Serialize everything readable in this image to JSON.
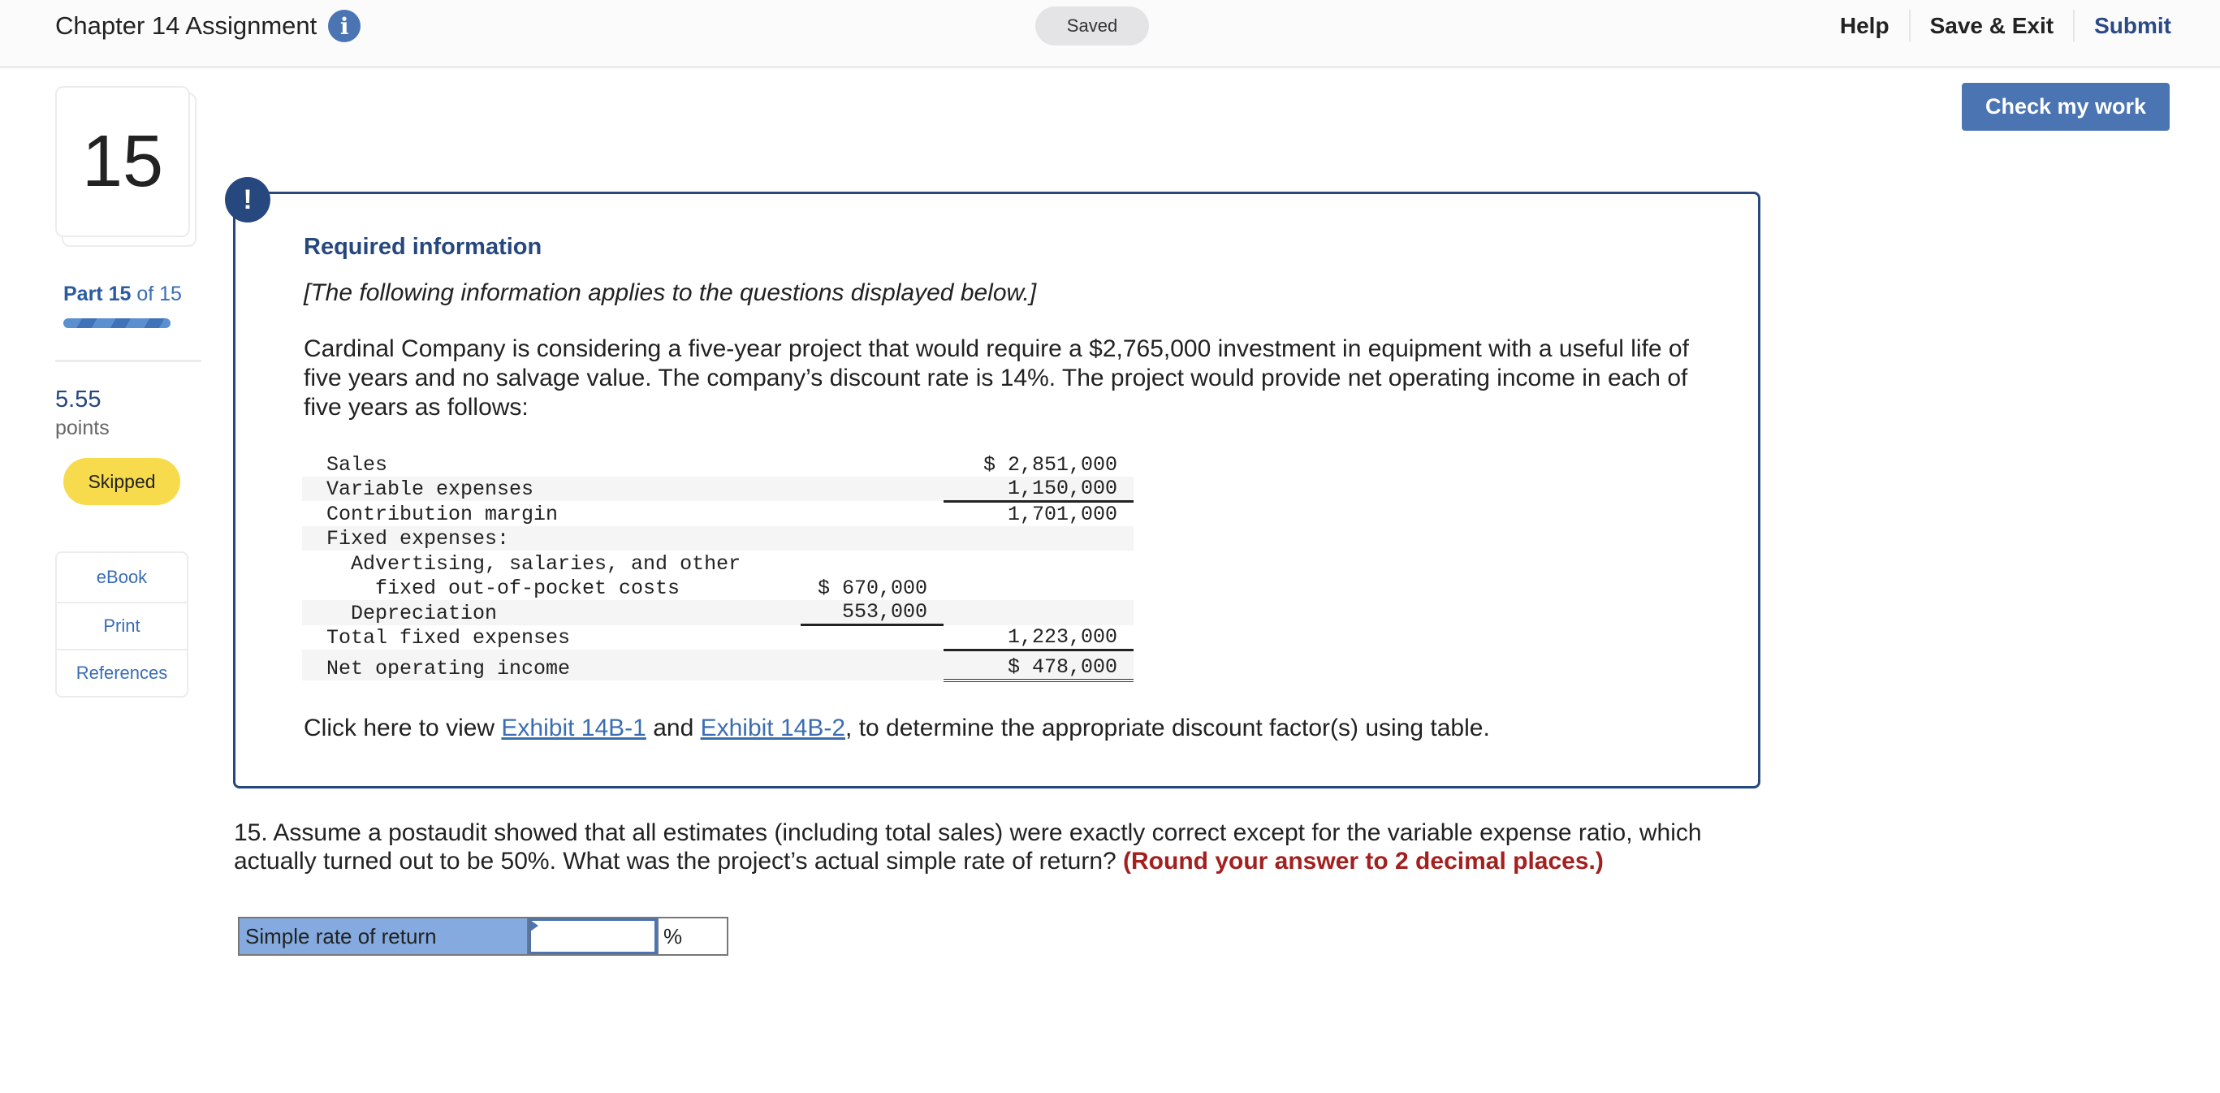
{
  "header": {
    "title": "Chapter 14 Assignment",
    "info_icon": "info-icon",
    "save_status": "Saved",
    "nav": {
      "help": "Help",
      "save_exit": "Save & Exit",
      "submit": "Submit"
    }
  },
  "check_work_label": "Check my work",
  "sidebar": {
    "question_number": "15",
    "part_prefix": "Part",
    "part_current": "15",
    "part_suffix": "of 15",
    "progress_fraction": 1.0,
    "points_value": "5.55",
    "points_label": "points",
    "status_badge": "Skipped",
    "tools": [
      {
        "label": "eBook"
      },
      {
        "label": "Print"
      },
      {
        "label": "References"
      }
    ]
  },
  "info_box": {
    "alert_icon": "exclamation-icon",
    "alert_glyph": "!",
    "title": "Required information",
    "subtitle": "[The following information applies to the questions displayed below.]",
    "paragraph": "Cardinal Company is considering a five-year project that would require a $2,765,000 investment in equipment with a useful life of five years and no salvage value. The company’s discount rate is 14%. The project would provide net operating income in each of five years as follows:",
    "income_statement": {
      "rows": [
        {
          "label": "Sales",
          "col1": "",
          "col2": "$ 2,851,000"
        },
        {
          "label": "Variable expenses",
          "col1": "",
          "col2": "1,150,000"
        },
        {
          "label": "Contribution margin",
          "col1": "",
          "col2": "1,701,000"
        },
        {
          "label": "Fixed expenses:",
          "col1": "",
          "col2": ""
        },
        {
          "label": "Advertising, salaries, and other",
          "col1": "",
          "col2": ""
        },
        {
          "label": "fixed out-of-pocket costs",
          "col1": "$ 670,000",
          "col2": ""
        },
        {
          "label": "Depreciation",
          "col1": "553,000",
          "col2": ""
        },
        {
          "label": "Total fixed expenses",
          "col1": "",
          "col2": "1,223,000"
        },
        {
          "label": "Net operating income",
          "col1": "",
          "col2": "$ 478,000"
        }
      ]
    },
    "exhibit_prefix": "Click here to view ",
    "exhibit_link_1": "Exhibit 14B-1",
    "exhibit_mid": " and ",
    "exhibit_link_2": "Exhibit 14B-2",
    "exhibit_suffix": ", to determine the appropriate discount factor(s) using table."
  },
  "question": {
    "text": "15. Assume a postaudit showed that all estimates (including total sales) were exactly correct except for the variable expense ratio, which actually turned out to be 50%. What was the project’s actual simple rate of return? ",
    "hint": "(Round your answer to 2 decimal places.)"
  },
  "answer": {
    "label": "Simple rate of return",
    "value": "",
    "unit": "%"
  },
  "colors": {
    "brand_blue": "#4b74b3",
    "navy": "#27477f",
    "skipped_yellow": "#f7db4c",
    "answer_label_bg": "#84aadf",
    "hint_red": "#a3201f"
  }
}
